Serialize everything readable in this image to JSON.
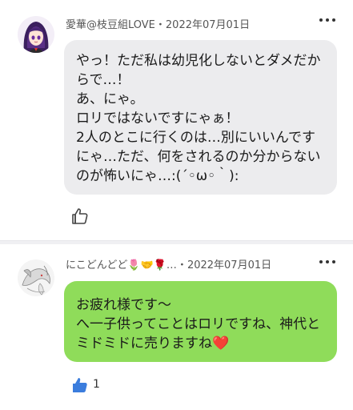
{
  "posts": [
    {
      "username": "愛華@枝豆組LOVE",
      "separator": "・",
      "date": "2022年07月01日",
      "message": "やっ！ただ私は幼児化しないとダメだからで…！\nあ、にゃ。\nロリではないですにゃぁ！\n2人のとこに行くのは…別にいいんですにゃ…ただ、何をされるのか分からないのが怖いにゃ…:(´◦ω◦｀):",
      "like_count": "",
      "liked": false,
      "avatar_icon": "anime-girl-avatar"
    },
    {
      "username": "にこどんどど",
      "username_emoji_suffix": "🌷🤝🌹…",
      "separator": "・",
      "date": "2022年07月01日",
      "message": "お疲れ様です〜\nへ一子供ってことはロリですね、神代とミドミドに売りますね",
      "message_emoji": "❤️",
      "like_count": "1",
      "liked": true,
      "avatar_icon": "white-dragon-avatar"
    }
  ],
  "colors": {
    "bubble_gray": "#ececee",
    "bubble_green": "#8fdc5a",
    "like_blue": "#3b7ddd"
  }
}
